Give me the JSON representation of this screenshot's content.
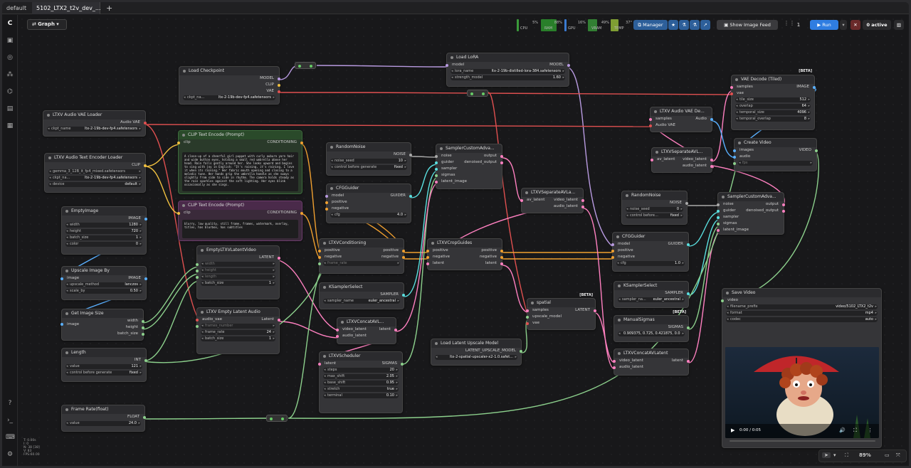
{
  "tabs": [
    {
      "label": "default"
    },
    {
      "label": "5102_LTX2_t2v_dev_..."
    }
  ],
  "graph_label": "Graph",
  "meters": [
    {
      "label": "CPU",
      "value": "5%",
      "color": "#3a9a3a"
    },
    {
      "label": "RAM",
      "value": "88%",
      "color": "#2e9a2e"
    },
    {
      "label": "GPU",
      "value": "16%",
      "color": "#3a7ad0"
    },
    {
      "label": "VRAM",
      "value": "49%",
      "color": "#3a9a3a"
    },
    {
      "label": "TEMP",
      "value": "37°",
      "color": "#9ac03a"
    }
  ],
  "toolbar": {
    "manager": "Manager",
    "show_image_feed": "Show Image Feed",
    "run_count": "1",
    "run": "Run",
    "active": "0 active",
    "zoom": "89%"
  },
  "status": {
    "l1": "T: 0.00s",
    "l2": "I: 0",
    "l3": "N: 38 [38]",
    "l4": "V: 83",
    "l5": "FPS:60.00"
  },
  "nodes": {
    "load_checkpoint": {
      "title": "Load Checkpoint",
      "o1": "MODEL",
      "o2": "CLIP",
      "o3": "VAE",
      "w_label": "ckpt_na...",
      "w_value": "ltx-2-19b-dev-fp4.safetensors"
    },
    "audio_vae_loader": {
      "title": "LTXV Audio VAE Loader",
      "o1": "Audio VAE",
      "w_label": "ckpt_name",
      "w_value": "ltx-2-19b-dev-fp4.safetensors"
    },
    "audio_text_encoder": {
      "title": "LTXV Audio Text Encoder Loader",
      "o1": "CLIP",
      "w1_label": "gemma_3_12B_it_fp4_mixed.safetensors",
      "w2_label": "ckpt_na...",
      "w2_value": "ltx-2-19b-dev-fp4.safetensors",
      "w3_label": "device",
      "w3_value": "default"
    },
    "clip_pos": {
      "title": "CLIP Text Encode (Prompt)",
      "i1": "clip",
      "o1": "CONDITIONING",
      "text": "A close-up of a cheerful girl puppet with curly auburn yarn hair and wide button eyes, holding a small red umbrella above her head. Rain falls gently around her. She looks upward and begins to sing with joy in English: \"It's raining, it's raining, I love it when its raining.\" Her fabric mouth opening and closing to a melodic tune. Her hands grip the umbrella handle as she sways slightly from side to side in rhythm. The camera holds steady as the rain sparkles against the soft lighting. Her eyes blink occasionally as she sings."
    },
    "clip_neg": {
      "title": "CLIP Text Encode (Prompt)",
      "i1": "clip",
      "o1": "CONDITIONING",
      "text": "blurry, low quality, still frame, frames, watermark, overlay, titles, has blurbox, has subtitles"
    },
    "empty_image": {
      "title": "EmptyImage",
      "o1": "IMAGE",
      "w1_label": "width",
      "w1_value": "1280",
      "w2_label": "height",
      "w2_value": "720",
      "w3_label": "batch_size",
      "w3_value": "1",
      "w4_label": "color",
      "w4_value": "0"
    },
    "upscale": {
      "title": "Upscale Image By",
      "i1": "image",
      "o1": "IMAGE",
      "w1_label": "upscale_method",
      "w1_value": "lanczos",
      "w2_label": "scale_by",
      "w2_value": "0.50"
    },
    "get_size": {
      "title": "Get Image Size",
      "i1": "image",
      "o1": "width",
      "o2": "height",
      "o3": "batch_size"
    },
    "length": {
      "title": "Length",
      "o1": "INT",
      "w1_label": "value",
      "w1_value": "121",
      "w2_label": "control before generate",
      "w2_value": "fixed"
    },
    "frame_rate": {
      "title": "Frame Rate(float)",
      "o1": "FLOAT",
      "w1_label": "value",
      "w1_value": "24.0"
    },
    "empty_latent_video": {
      "title": "EmptyLTXVLatentVideo",
      "o1": "LATENT",
      "w1": "width",
      "w2": "height",
      "w3": "length",
      "w4_label": "batch_size",
      "w4_value": "1"
    },
    "empty_latent_audio": {
      "title": "LTXV Empty Latent Audio",
      "i1": "audio_vae",
      "o1": "Latent",
      "w1": "frames_number",
      "w2_label": "frame_rate",
      "w2_value": "24",
      "w3_label": "batch_size",
      "w3_value": "1"
    },
    "random_noise": {
      "title": "RandomNoise",
      "o1": "NOISE",
      "w1_label": "noise_seed",
      "w1_value": "10",
      "w2_label": "control before generate",
      "w2_value": "fixed"
    },
    "cfg_guider": {
      "title": "CFGGuider",
      "i1": "model",
      "i2": "positive",
      "i3": "negative",
      "o1": "GUIDER",
      "w1_label": "cfg",
      "w1_value": "4.0"
    },
    "conditioning": {
      "title": "LTXVConditioning",
      "i1": "positive",
      "i2": "negative",
      "o1": "positive",
      "o2": "negative",
      "w1": "frame_rate"
    },
    "ksampler_select": {
      "title": "KSamplerSelect",
      "o1": "SAMPLER",
      "w1_label": "sampler_name",
      "w1_value": "euler_ancestral"
    },
    "concat_av": {
      "title": "LTXVConcatAVL...",
      "i1": "video_latent",
      "i2": "audio_latent",
      "o1": "latent"
    },
    "scheduler": {
      "title": "LTXVScheduler",
      "i1": "latent",
      "o1": "SIGMAS",
      "w1_label": "steps",
      "w1_value": "20",
      "w2_label": "max_shift",
      "w2_value": "2.05",
      "w3_label": "base_shift",
      "w3_value": "0.95",
      "w4_label": "stretch",
      "w4_value": "true",
      "w5_label": "terminal",
      "w5_value": "0.10"
    },
    "sampler_custom": {
      "title": "SamplerCustomAdva...",
      "i1": "noise",
      "i2": "guider",
      "i3": "sampler",
      "i4": "sigmas",
      "i5": "latent_image",
      "o1": "output",
      "o2": "denoised_output"
    },
    "crop_guides": {
      "title": "LTXVCropGuides",
      "i1": "positive",
      "i2": "negative",
      "i3": "latent",
      "o1": "positive",
      "o2": "negative",
      "o3": "latent"
    },
    "separate_av": {
      "title": "LTXVSeparateAVLa...",
      "i1": "av_latent",
      "o1": "video_latent",
      "o2": "audio_latent"
    },
    "load_lora": {
      "title": "Load LoRA",
      "i1": "model",
      "o1": "MODEL",
      "w1_label": "lora_name",
      "w1_value": "ltx-2-19b-distilled-lora-384.safetensors",
      "w2_label": "strength_model",
      "w2_value": "1.60"
    },
    "spatial": {
      "title": "spatial",
      "badge": "[BETA]",
      "i1": "samples",
      "i2": "upscale_model",
      "i3": "vae",
      "o1": "LATENT"
    },
    "upscale_model": {
      "title": "Load Latent Upscale Model",
      "o1": "LATENT_UPSCALE_MODEL",
      "w1_value": "ltx-2-spatial-upscaler-x2-1.0.safet..."
    },
    "random_noise2": {
      "title": "RandomNoise",
      "o1": "NOISE",
      "w1_label": "noise_seed",
      "w1_value": "0",
      "w2_label": "control before...",
      "w2_value": "fixed"
    },
    "cfg_guider2": {
      "title": "CFGGuider",
      "i1": "model",
      "i2": "positive",
      "i3": "negative",
      "o1": "GUIDER",
      "w1_label": "cfg",
      "w1_value": "1.0"
    },
    "ksampler_select2": {
      "title": "KSamplerSelect",
      "o1": "SAMPLER",
      "w1_label": "sampler_na...",
      "w1_value": "euler_ancestral"
    },
    "manual_sigmas": {
      "title": "ManualSigmas",
      "badge": "[BETA]",
      "o1": "SIGMAS",
      "w1_value": "0.909375, 0.725, 0.421875, 0.0"
    },
    "concat_av2": {
      "title": "LTXVConcatAVLatent",
      "i1": "video_latent",
      "i2": "audio_latent",
      "o1": "latent"
    },
    "sampler_custom2": {
      "title": "SamplerCustomAdva...",
      "i1": "noise",
      "i2": "guider",
      "i3": "sampler",
      "i4": "sigmas",
      "i5": "latent_image",
      "o1": "output",
      "o2": "denoised_output"
    },
    "separate_av2": {
      "title": "LTXVSeparateAVL...",
      "i1": "av_latent",
      "o1": "video_latent",
      "o2": "audio_latent"
    },
    "audio_vae_decode": {
      "title": "LTXV Audio VAE De...",
      "i1": "samples",
      "i2": "Audio VAE",
      "o1": "Audio"
    },
    "vae_decode_tiled": {
      "title": "VAE Decode (Tiled)",
      "badge": "[BETA]",
      "i1": "samples",
      "i2": "vae",
      "o1": "IMAGE",
      "w1_label": "tile_size",
      "w1_value": "512",
      "w2_label": "overlap",
      "w2_value": "64",
      "w3_label": "temporal_size",
      "w3_value": "4096",
      "w4_label": "temporal_overlap",
      "w4_value": "8"
    },
    "create_video": {
      "title": "Create Video",
      "i1": "images",
      "i2": "audio",
      "i3": "fps",
      "o1": "VIDEO"
    },
    "save_video": {
      "title": "Save Video",
      "i1": "video",
      "w1_label": "filename_prefix",
      "w1_value": "video/5102_LTX2_t2v",
      "w2_label": "format",
      "w2_value": "mp4",
      "w3_label": "codec",
      "w3_value": "auto",
      "time": "0:00 / 0:05"
    }
  }
}
